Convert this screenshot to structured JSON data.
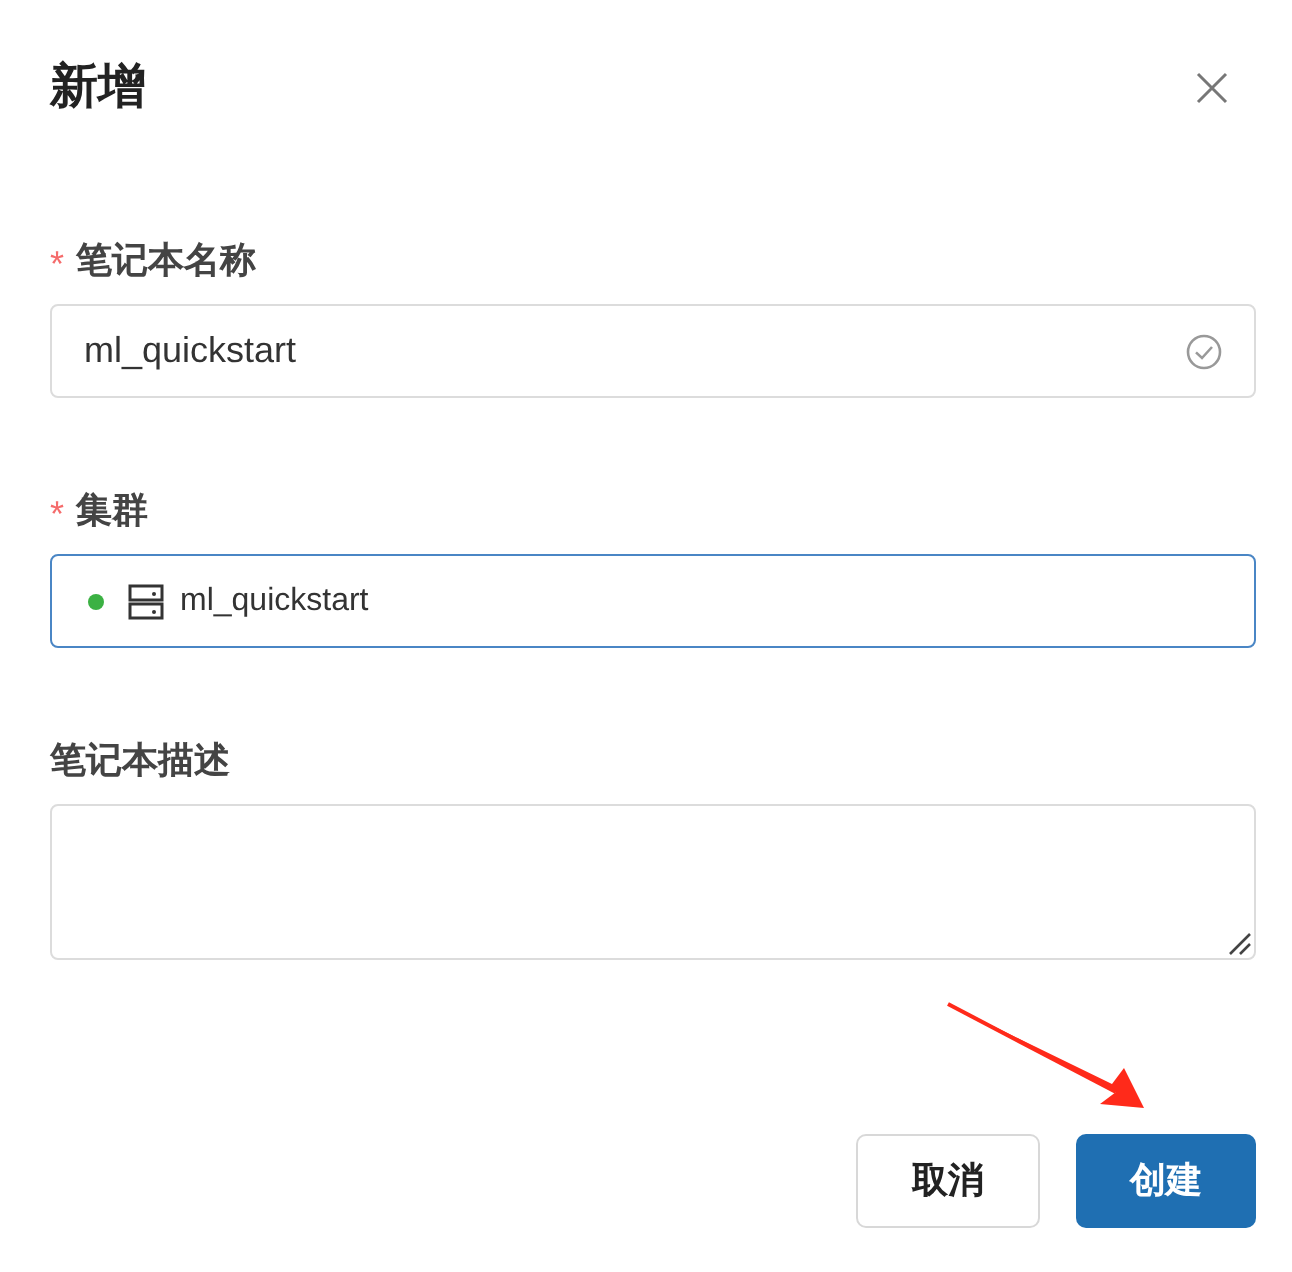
{
  "dialog": {
    "title": "新增"
  },
  "fields": [
    {
      "kind": "text",
      "label": "笔记本名称",
      "required_mark": "*",
      "value": "ml_quickstart",
      "valid": true,
      "focused": false
    },
    {
      "kind": "select",
      "label": "集群",
      "required_mark": "*",
      "value": "ml_quickstart",
      "color": "#3bb143",
      "focused": true
    },
    {
      "kind": "textarea",
      "label": "笔记本描述",
      "focused": false
    }
  ],
  "buttons": [
    {
      "kind": "secondary",
      "label": "取消"
    },
    {
      "kind": "primary",
      "label": "创建"
    }
  ]
}
